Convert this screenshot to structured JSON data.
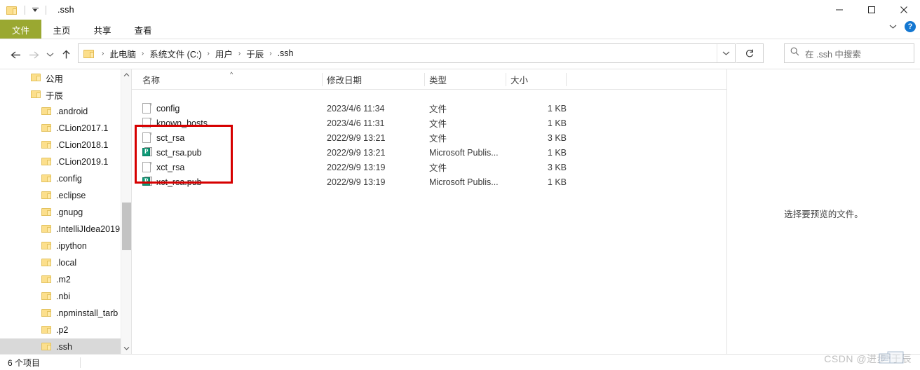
{
  "window": {
    "title": ".ssh",
    "quick_access": [
      "folder-icon",
      "customize-dropdown"
    ],
    "controls": {
      "minimize": "—",
      "maximize": "□",
      "close": "✕"
    }
  },
  "ribbon": {
    "tabs": [
      {
        "label": "文件",
        "active": true
      },
      {
        "label": "主页",
        "active": false
      },
      {
        "label": "共享",
        "active": false
      },
      {
        "label": "查看",
        "active": false
      }
    ],
    "accent_color": "#9aa831",
    "help_label": "?",
    "collapse_icon": "chevron-down-icon"
  },
  "address": {
    "back_icon": "arrow-left-icon",
    "forward_icon": "arrow-right-icon",
    "recent_icon": "chevron-down-icon",
    "up_icon": "arrow-up-icon",
    "breadcrumbs": [
      "此电脑",
      "系统文件 (C:)",
      "用户",
      "于辰",
      ".ssh"
    ],
    "separator": "›",
    "dropdown_icon": "chevron-down-icon",
    "refresh_icon": "refresh-icon"
  },
  "search": {
    "placeholder": "在 .ssh 中搜索",
    "icon": "search-icon",
    "value": ""
  },
  "nav_pane": {
    "items": [
      {
        "label": "公用",
        "indent": 0,
        "selected": false
      },
      {
        "label": "于辰",
        "indent": 0,
        "selected": false
      },
      {
        "label": ".android",
        "indent": 1,
        "selected": false
      },
      {
        "label": ".CLion2017.1",
        "indent": 1,
        "selected": false
      },
      {
        "label": ".CLion2018.1",
        "indent": 1,
        "selected": false
      },
      {
        "label": ".CLion2019.1",
        "indent": 1,
        "selected": false
      },
      {
        "label": ".config",
        "indent": 1,
        "selected": false
      },
      {
        "label": ".eclipse",
        "indent": 1,
        "selected": false
      },
      {
        "label": ".gnupg",
        "indent": 1,
        "selected": false
      },
      {
        "label": ".IntelliJIdea2019",
        "indent": 1,
        "selected": false
      },
      {
        "label": ".ipython",
        "indent": 1,
        "selected": false
      },
      {
        "label": ".local",
        "indent": 1,
        "selected": false
      },
      {
        "label": ".m2",
        "indent": 1,
        "selected": false
      },
      {
        "label": ".nbi",
        "indent": 1,
        "selected": false
      },
      {
        "label": ".npminstall_tarb",
        "indent": 1,
        "selected": false
      },
      {
        "label": ".p2",
        "indent": 1,
        "selected": false
      },
      {
        "label": ".ssh",
        "indent": 1,
        "selected": true
      }
    ],
    "scroll_up_icon": "chevron-up-icon",
    "scroll_down_icon": "chevron-down-icon"
  },
  "file_list": {
    "columns": [
      {
        "label": "名称",
        "sorted": "asc",
        "sort_caret": "^"
      },
      {
        "label": "修改日期",
        "sorted": ""
      },
      {
        "label": "类型",
        "sorted": ""
      },
      {
        "label": "大小",
        "sorted": ""
      }
    ],
    "rows": [
      {
        "name": "config",
        "date": "2023/4/6 11:34",
        "type": "文件",
        "size": "1 KB",
        "icon": "generic-file-icon",
        "highlighted": false
      },
      {
        "name": "known_hosts",
        "date": "2023/4/6 11:31",
        "type": "文件",
        "size": "1 KB",
        "icon": "generic-file-icon",
        "highlighted": false
      },
      {
        "name": "sct_rsa",
        "date": "2022/9/9 13:21",
        "type": "文件",
        "size": "3 KB",
        "icon": "generic-file-icon",
        "highlighted": true
      },
      {
        "name": "sct_rsa.pub",
        "date": "2022/9/9 13:21",
        "type": "Microsoft Publis...",
        "size": "1 KB",
        "icon": "publisher-file-icon",
        "highlighted": true
      },
      {
        "name": "xct_rsa",
        "date": "2022/9/9 13:19",
        "type": "文件",
        "size": "3 KB",
        "icon": "generic-file-icon",
        "highlighted": true
      },
      {
        "name": "xct_rsa.pub",
        "date": "2022/9/9 13:19",
        "type": "Microsoft Publis...",
        "size": "1 KB",
        "icon": "publisher-file-icon",
        "highlighted": true
      }
    ],
    "annotation_color": "#d60000"
  },
  "preview_pane": {
    "message": "选择要预览的文件。"
  },
  "status_bar": {
    "item_count": "6 个项目"
  },
  "watermark": {
    "text": "CSDN @进步*于辰"
  }
}
